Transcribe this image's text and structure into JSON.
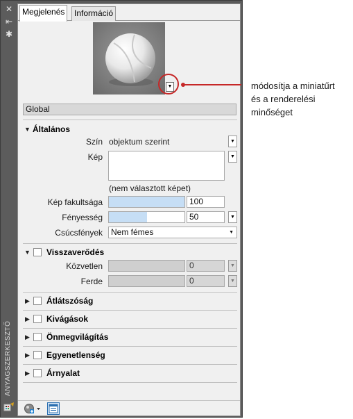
{
  "palette": {
    "vertical_title": "ANYAGSZERKESZTŐ",
    "close_glyph": "✕",
    "autohide_glyph": "⇤",
    "props_glyph": "✱"
  },
  "tabs": [
    {
      "label": "Megjelenés",
      "active": true
    },
    {
      "label": "Információ",
      "active": false
    }
  ],
  "preview": {
    "name_field": "Global"
  },
  "general": {
    "title": "Általános",
    "color_label": "Szín",
    "color_value": "objektum szerint",
    "image_label": "Kép",
    "image_caption": "(nem választott képet)",
    "image_fade_label": "Kép fakultsága",
    "image_fade_value": "100",
    "image_fade_level": 1.0,
    "gloss_label": "Fényesség",
    "gloss_value": "50",
    "gloss_level": 0.5,
    "highlights_label": "Csúcsfények",
    "highlights_value": "Nem fémes"
  },
  "reflectivity": {
    "title": "Visszaverődés",
    "direct_label": "Közvetlen",
    "direct_value": "0",
    "oblique_label": "Ferde",
    "oblique_value": "0"
  },
  "sections": [
    {
      "title": "Átlátszóság"
    },
    {
      "title": "Kivágások"
    },
    {
      "title": "Önmegvilágítás"
    },
    {
      "title": "Egyenetlenség"
    },
    {
      "title": "Árnyalat"
    }
  ],
  "callout": {
    "line1": "módosítja a miniatűrt",
    "line2": "és a renderelési",
    "line3": "minőséget"
  },
  "colors": {
    "accent_red": "#c62828",
    "slider_fill": "#c6def5",
    "frame_gray": "#5a5a5a"
  }
}
